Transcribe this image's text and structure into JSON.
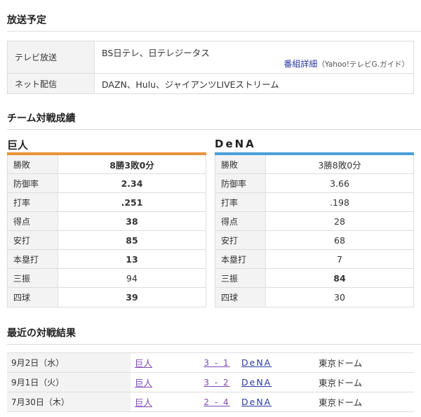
{
  "broadcast": {
    "title": "放送予定",
    "tv_label": "テレビ放送",
    "tv_value": "BS日テレ、日テレジータス",
    "detail_link": "番組詳細",
    "detail_source": "（Yahoo!テレビG.ガイド）",
    "net_label": "ネット配信",
    "net_value": "DAZN、Hulu、ジャイアンツLIVEストリーム"
  },
  "matchup": {
    "title": "チーム対戦成績",
    "colors": {
      "giants": "#e8923a",
      "dena": "#4a9fd8"
    },
    "giants": {
      "name": "巨人",
      "rows": [
        {
          "label": "勝敗",
          "value": "8勝3敗0分"
        },
        {
          "label": "防御率",
          "value": "2.34"
        },
        {
          "label": "打率",
          "value": ".251"
        },
        {
          "label": "得点",
          "value": "38"
        },
        {
          "label": "安打",
          "value": "85"
        },
        {
          "label": "本塁打",
          "value": "13"
        },
        {
          "label": "三振",
          "value": "94"
        },
        {
          "label": "四球",
          "value": "39"
        }
      ]
    },
    "dena": {
      "name": "DeNA",
      "rows": [
        {
          "label": "勝敗",
          "value": "3勝8敗0分"
        },
        {
          "label": "防御率",
          "value": "3.66"
        },
        {
          "label": "打率",
          "value": ".198"
        },
        {
          "label": "得点",
          "value": "28"
        },
        {
          "label": "安打",
          "value": "68"
        },
        {
          "label": "本塁打",
          "value": "7"
        },
        {
          "label": "三振",
          "value": "84"
        },
        {
          "label": "四球",
          "value": "30"
        }
      ]
    }
  },
  "results": {
    "title": "最近の対戦結果",
    "rows": [
      {
        "date": "9月2日（水）",
        "home": "巨人",
        "score": "3 - 1",
        "away": "DeNA",
        "venue": "東京ドーム"
      },
      {
        "date": "9月1日（火）",
        "home": "巨人",
        "score": "3 - 2",
        "away": "DeNA",
        "venue": "東京ドーム"
      },
      {
        "date": "7月30日（木）",
        "home": "巨人",
        "score": "2 - 4",
        "away": "DeNA",
        "venue": "東京ドーム"
      }
    ]
  }
}
